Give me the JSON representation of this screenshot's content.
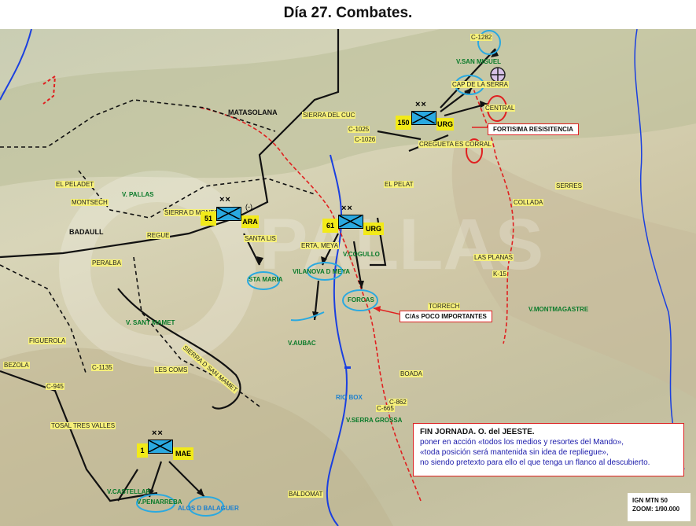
{
  "title": "Día 27. Combates.",
  "map": {
    "place_labels": [
      {
        "id": "matasolana",
        "text": "MATASOLANA",
        "style": "bl"
      },
      {
        "id": "badaull",
        "text": "BADAULL",
        "style": "bl"
      },
      {
        "id": "montsech",
        "text": "MONTSECH",
        "style": "yl"
      },
      {
        "id": "el-peladet",
        "text": "EL PELADET",
        "style": "yl"
      },
      {
        "id": "regue",
        "text": "REGUE",
        "style": "yl"
      },
      {
        "id": "santa-lis",
        "text": "SANTA LIS",
        "style": "yl"
      },
      {
        "id": "peralba",
        "text": "PERALBA",
        "style": "yl"
      },
      {
        "id": "figuerola",
        "text": "FIGUEROLA",
        "style": "yl"
      },
      {
        "id": "bezola",
        "text": "BEZOLA",
        "style": "yl"
      },
      {
        "id": "c-1135",
        "text": "C-1135",
        "style": "yl"
      },
      {
        "id": "les-coms",
        "text": "LES COMS",
        "style": "yl"
      },
      {
        "id": "tosal-tres-valles",
        "text": "TOSAL TRES VALLES",
        "style": "yl"
      },
      {
        "id": "baldomat",
        "text": "BALDOMAT",
        "style": "yl"
      },
      {
        "id": "boada",
        "text": "BOADA",
        "style": "yl"
      },
      {
        "id": "torrech",
        "text": "TORRECH",
        "style": "yl"
      },
      {
        "id": "las-planas",
        "text": "LAS PLANAS",
        "style": "yl"
      },
      {
        "id": "k-15",
        "text": "K-15",
        "style": "yl"
      },
      {
        "id": "collada",
        "text": "COLLADA",
        "style": "yl"
      },
      {
        "id": "serres",
        "text": "SERRES",
        "style": "yl"
      },
      {
        "id": "el-pelat",
        "text": "EL PELAT",
        "style": "yl"
      },
      {
        "id": "creguetat",
        "text": "CREGUETA ES CORRAL",
        "style": "yl"
      },
      {
        "id": "central",
        "text": "CENTRAL",
        "style": "yl"
      },
      {
        "id": "cap-de-la-serra",
        "text": "CAP DE LA SERRA",
        "style": "yl"
      },
      {
        "id": "c-1282",
        "text": "C-1282",
        "style": "yl"
      },
      {
        "id": "sierra-del-cuc",
        "text": "SIERRA DEL CUC",
        "style": "yl"
      },
      {
        "id": "c-1025",
        "text": "C-1025",
        "style": "yl"
      },
      {
        "id": "c-1026",
        "text": "C-1026",
        "style": "yl"
      },
      {
        "id": "erta-meya",
        "text": "ERTA, MEYA",
        "style": "yl"
      },
      {
        "id": "sierra-d-mt",
        "text": "SIERRA D MONTSECH",
        "style": "yl"
      },
      {
        "id": "c-945",
        "text": "C-945",
        "style": "yl"
      },
      {
        "id": "c-665",
        "text": "C-665",
        "style": "yl"
      },
      {
        "id": "c-862",
        "text": "C-862",
        "style": "yl"
      },
      {
        "id": "sierra-d-san-mamet",
        "text": "SIERRA D SAN MAMET",
        "style": "yl"
      }
    ],
    "green_labels": [
      {
        "id": "v-pallas",
        "text": "V. PALLAS"
      },
      {
        "id": "v-san-miguel",
        "text": "V.SAN MIGUEL"
      },
      {
        "id": "v-cogullo",
        "text": "V.COGULLO"
      },
      {
        "id": "vilanova-d-meya",
        "text": "VILANOVA D MEYA"
      },
      {
        "id": "sta-maria",
        "text": "STA MARIA"
      },
      {
        "id": "forcas",
        "text": "FORCAS"
      },
      {
        "id": "v-sant-mamet",
        "text": "V. SANT MAMET"
      },
      {
        "id": "v-aubac",
        "text": "V.AUBAC"
      },
      {
        "id": "v-montmagastre",
        "text": "V.MONTMAGASTRE"
      },
      {
        "id": "rio-box",
        "text": "RIO BOX"
      },
      {
        "id": "v-serra-grossa",
        "text": "V.SERRA GROSSA"
      },
      {
        "id": "v-castellar",
        "text": "V.CASTELLAR"
      },
      {
        "id": "v-penarreba",
        "text": "V.PENARREBA"
      },
      {
        "id": "alos-d-balaguer",
        "text": "ALOS D BALAGUER"
      }
    ],
    "units": [
      {
        "id": "unit-150",
        "number": "150",
        "name": "URG",
        "echelon": "××"
      },
      {
        "id": "unit-51",
        "number": "51",
        "name": "ARA",
        "echelon": "××",
        "modifier": "(-)"
      },
      {
        "id": "unit-61",
        "number": "61",
        "name": "URG",
        "echelon": "××"
      },
      {
        "id": "unit-1",
        "number": "1",
        "name": "MAE",
        "echelon": "××"
      }
    ],
    "callouts": {
      "fortisima": "FORTISIMA RESISITENCIA",
      "poco_importantes": "C/As POCO IMPORTANTES"
    },
    "order": {
      "head": "FIN JORNADA. O. del JEESTE.",
      "line1": "poner en acción «todos los medios y resortes del Mando»,",
      "line2": "«toda posición será mantenida sin idea de repliegue»,",
      "line3": "no siendo pretexto para ello el que tenga un flanco al descubierto."
    },
    "scale": {
      "line1": "IGN MTN 50",
      "line2": "ZOOM: 1/90.000"
    },
    "colors": {
      "unit_fill": "#2aa9e0",
      "unit_label": "#f2ea19",
      "front_line": "#e02020",
      "river": "#1a3fe0",
      "ellipse": "#2aa9e0",
      "callout_border": "#dd2222"
    }
  }
}
